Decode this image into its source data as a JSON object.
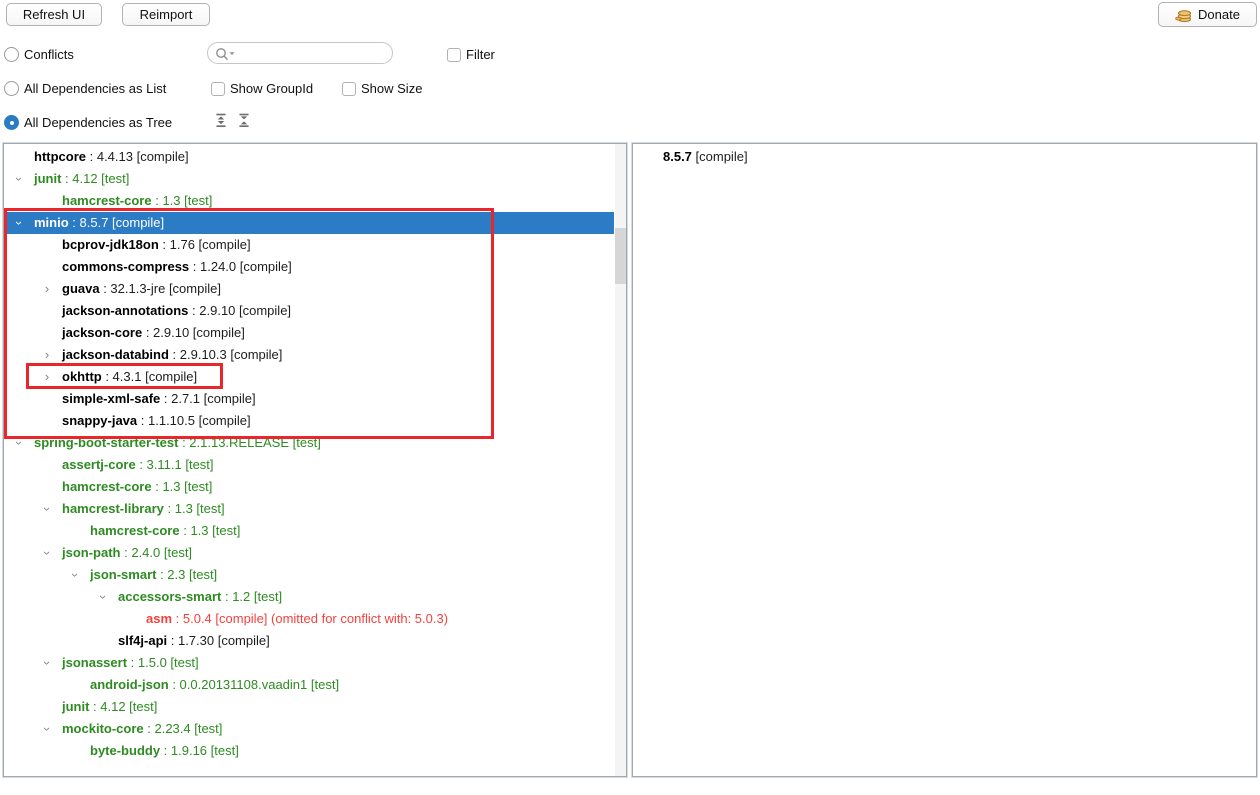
{
  "toolbar": {
    "refresh_label": "Refresh UI",
    "reimport_label": "Reimport",
    "donate_label": "Donate"
  },
  "filters": {
    "conflicts": {
      "label": "Conflicts",
      "selected": false
    },
    "as_list": {
      "label": "All Dependencies as List",
      "selected": false
    },
    "as_tree": {
      "label": "All Dependencies as Tree",
      "selected": true
    },
    "search": {
      "value": "",
      "placeholder": ""
    },
    "filter_checkbox": {
      "label": "Filter",
      "checked": false
    },
    "show_groupid": {
      "label": "Show GroupId",
      "checked": false
    },
    "show_size": {
      "label": "Show Size",
      "checked": false
    }
  },
  "icons": {
    "donate": "coins-icon",
    "search": "magnifier-with-dropdown-icon",
    "expand_all": "expand-all-icon",
    "collapse_all": "collapse-all-icon",
    "chevron_collapsed": "›",
    "chevron_expanded": "› rotated 90deg"
  },
  "colors": {
    "selection_bg": "#2b7bc5",
    "test_scope_green": "#2e8b22",
    "compile_scope_black": "#000000",
    "conflict_red": "#f5413d",
    "annotation_red": "#e8262b"
  },
  "left_tree": {
    "rows": [
      {
        "name": "httpcore",
        "version": "4.4.13",
        "scope": "compile",
        "type": "compile",
        "level": 0,
        "chevron": "none",
        "selected": false
      },
      {
        "name": "junit",
        "version": "4.12",
        "scope": "test",
        "type": "test",
        "level": 0,
        "chevron": "expanded",
        "selected": false
      },
      {
        "name": "hamcrest-core",
        "version": "1.3",
        "scope": "test",
        "type": "test",
        "level": 1,
        "chevron": "none",
        "selected": false
      },
      {
        "name": "minio",
        "version": "8.5.7",
        "scope": "compile",
        "type": "compile",
        "level": 0,
        "chevron": "expanded",
        "selected": true
      },
      {
        "name": "bcprov-jdk18on",
        "version": "1.76",
        "scope": "compile",
        "type": "compile",
        "level": 1,
        "chevron": "none",
        "selected": false
      },
      {
        "name": "commons-compress",
        "version": "1.24.0",
        "scope": "compile",
        "type": "compile",
        "level": 1,
        "chevron": "none",
        "selected": false
      },
      {
        "name": "guava",
        "version": "32.1.3-jre",
        "scope": "compile",
        "type": "compile",
        "level": 1,
        "chevron": "collapsed",
        "selected": false
      },
      {
        "name": "jackson-annotations",
        "version": "2.9.10",
        "scope": "compile",
        "type": "compile",
        "level": 1,
        "chevron": "none",
        "selected": false
      },
      {
        "name": "jackson-core",
        "version": "2.9.10",
        "scope": "compile",
        "type": "compile",
        "level": 1,
        "chevron": "none",
        "selected": false
      },
      {
        "name": "jackson-databind",
        "version": "2.9.10.3",
        "scope": "compile",
        "type": "compile",
        "level": 1,
        "chevron": "collapsed",
        "selected": false
      },
      {
        "name": "okhttp",
        "version": "4.3.1",
        "scope": "compile",
        "type": "compile",
        "level": 1,
        "chevron": "collapsed",
        "selected": false
      },
      {
        "name": "simple-xml-safe",
        "version": "2.7.1",
        "scope": "compile",
        "type": "compile",
        "level": 1,
        "chevron": "none",
        "selected": false
      },
      {
        "name": "snappy-java",
        "version": "1.1.10.5",
        "scope": "compile",
        "type": "compile",
        "level": 1,
        "chevron": "none",
        "selected": false
      },
      {
        "name": "spring-boot-starter-test",
        "version": "2.1.13.RELEASE",
        "scope": "test",
        "type": "test",
        "level": 0,
        "chevron": "expanded",
        "selected": false
      },
      {
        "name": "assertj-core",
        "version": "3.11.1",
        "scope": "test",
        "type": "test",
        "level": 1,
        "chevron": "none",
        "selected": false
      },
      {
        "name": "hamcrest-core",
        "version": "1.3",
        "scope": "test",
        "type": "test",
        "level": 1,
        "chevron": "none",
        "selected": false
      },
      {
        "name": "hamcrest-library",
        "version": "1.3",
        "scope": "test",
        "type": "test",
        "level": 1,
        "chevron": "expanded",
        "selected": false
      },
      {
        "name": "hamcrest-core",
        "version": "1.3",
        "scope": "test",
        "type": "test",
        "level": 2,
        "chevron": "none",
        "selected": false
      },
      {
        "name": "json-path",
        "version": "2.4.0",
        "scope": "test",
        "type": "test",
        "level": 1,
        "chevron": "expanded",
        "selected": false
      },
      {
        "name": "json-smart",
        "version": "2.3",
        "scope": "test",
        "type": "test",
        "level": 2,
        "chevron": "expanded",
        "selected": false
      },
      {
        "name": "accessors-smart",
        "version": "1.2",
        "scope": "test",
        "type": "test",
        "level": 3,
        "chevron": "expanded",
        "selected": false
      },
      {
        "name": "asm",
        "version": "5.0.4",
        "scope": "compile",
        "type": "conflict",
        "level": 4,
        "chevron": "none",
        "selected": false,
        "note": "(omitted for conflict with: 5.0.3)"
      },
      {
        "name": "slf4j-api",
        "version": "1.7.30",
        "scope": "compile",
        "type": "compile",
        "level": 3,
        "chevron": "none",
        "selected": false
      },
      {
        "name": "jsonassert",
        "version": "1.5.0",
        "scope": "test",
        "type": "test",
        "level": 1,
        "chevron": "expanded",
        "selected": false
      },
      {
        "name": "android-json",
        "version": "0.0.20131108.vaadin1",
        "scope": "test",
        "type": "test",
        "level": 2,
        "chevron": "none",
        "selected": false
      },
      {
        "name": "junit",
        "version": "4.12",
        "scope": "test",
        "type": "test",
        "level": 1,
        "chevron": "none",
        "selected": false
      },
      {
        "name": "mockito-core",
        "version": "2.23.4",
        "scope": "test",
        "type": "test",
        "level": 1,
        "chevron": "expanded",
        "selected": false
      },
      {
        "name": "byte-buddy",
        "version": "1.9.16",
        "scope": "test",
        "type": "test",
        "level": 2,
        "chevron": "none",
        "selected": false
      }
    ]
  },
  "right_tree": {
    "rows": [
      {
        "name": "8.5.7",
        "version": null,
        "scope": "compile",
        "type": "compile",
        "level": 0,
        "chevron": "none",
        "selected": false
      }
    ]
  },
  "annotations": {
    "outer_box_target": "minio-subtree",
    "inner_box_target": "okhttp-row"
  }
}
